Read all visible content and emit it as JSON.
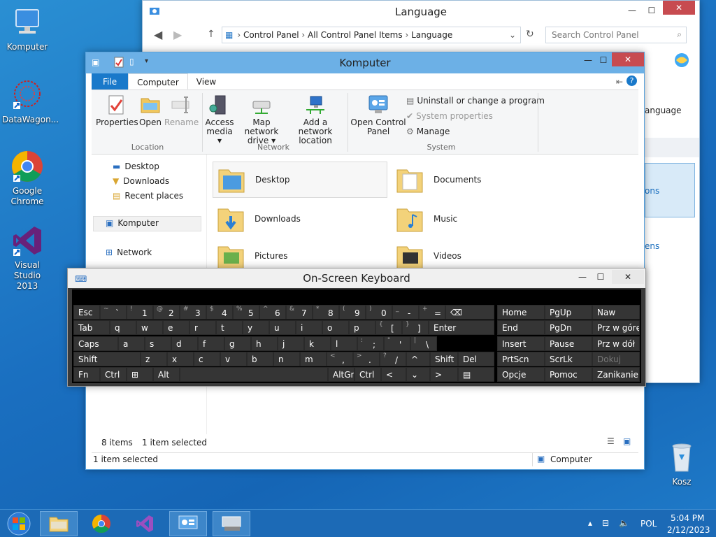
{
  "desktop": {
    "icons": [
      {
        "label": "Komputer"
      },
      {
        "label": "DataWagon..."
      },
      {
        "label": "Google Chrome"
      },
      {
        "label": "Visual Studio 2013"
      },
      {
        "label": "Kosz"
      }
    ]
  },
  "language_window": {
    "title": "Language",
    "breadcrumb": [
      "Control Panel",
      "All Control Panel Items",
      "Language"
    ],
    "search_placeholder": "Search Control Panel",
    "right_text": "anguage",
    "link1": "ons",
    "link2": "ens"
  },
  "komputer_window": {
    "title": "Komputer",
    "tabs": [
      "File",
      "Computer",
      "View"
    ],
    "ribbon": {
      "properties": "Properties",
      "open": "Open",
      "rename": "Rename",
      "location_group": "Location",
      "access_media": "Access media ▾",
      "map_network_drive": "Map network drive ▾",
      "add_network_location": "Add a network location",
      "network_group": "Network",
      "open_control_panel": "Open Control Panel",
      "uninstall": "Uninstall or change a program",
      "system_properties": "System properties",
      "manage": "Manage",
      "system_group": "System"
    },
    "nav": {
      "desktop": "Desktop",
      "downloads": "Downloads",
      "recent": "Recent places",
      "komputer": "Komputer",
      "network": "Network"
    },
    "folders": [
      "Desktop",
      "Documents",
      "Downloads",
      "Music",
      "Pictures",
      "Videos"
    ],
    "status_items": "8 items",
    "status_selected": "1 item selected",
    "status_bar_left": "1 item selected",
    "status_bar_right": "Computer"
  },
  "osk": {
    "title": "On-Screen Keyboard",
    "row1": [
      {
        "sub": "~",
        "main": "`"
      },
      {
        "sub": "!",
        "main": "1"
      },
      {
        "sub": "@",
        "main": "2"
      },
      {
        "sub": "#",
        "main": "3"
      },
      {
        "sub": "$",
        "main": "4"
      },
      {
        "sub": "%",
        "main": "5"
      },
      {
        "sub": "^",
        "main": "6"
      },
      {
        "sub": "&",
        "main": "7"
      },
      {
        "sub": "*",
        "main": "8"
      },
      {
        "sub": "(",
        "main": "9"
      },
      {
        "sub": ")",
        "main": "0"
      },
      {
        "sub": "_",
        "main": "-"
      },
      {
        "sub": "+",
        "main": "="
      }
    ],
    "row2": [
      "q",
      "w",
      "e",
      "r",
      "t",
      "y",
      "u",
      "i",
      "o",
      "p"
    ],
    "row2_brackets": [
      {
        "sub": "{",
        "main": "["
      },
      {
        "sub": "}",
        "main": "]"
      }
    ],
    "row3": [
      "a",
      "s",
      "d",
      "f",
      "g",
      "h",
      "j",
      "k",
      "l"
    ],
    "row3_punct": [
      {
        "sub": ":",
        "main": ";"
      },
      {
        "sub": "\"",
        "main": "'"
      },
      {
        "sub": "|",
        "main": "\\"
      }
    ],
    "row4": [
      "z",
      "x",
      "c",
      "v",
      "b",
      "n",
      "m"
    ],
    "row4_punct": [
      {
        "sub": "<",
        "main": ","
      },
      {
        "sub": ">",
        "main": "."
      },
      {
        "sub": "?",
        "main": "/"
      }
    ],
    "keys": {
      "esc": "Esc",
      "tab": "Tab",
      "caps": "Caps",
      "shift": "Shift",
      "fn": "Fn",
      "ctrl": "Ctrl",
      "alt": "Alt",
      "altgr": "AltGr",
      "enter": "Enter",
      "del": "Del",
      "up": "^",
      "left": "<",
      "down": "⌄",
      "right": ">"
    },
    "nav_keys": [
      [
        "Home",
        "PgUp",
        "Naw"
      ],
      [
        "End",
        "PgDn",
        "Prz w górę"
      ],
      [
        "Insert",
        "Pause",
        "Prz w dół"
      ],
      [
        "PrtScn",
        "ScrLk",
        "Dokuj"
      ],
      [
        "Opcje",
        "Pomoc",
        "Zanikanie"
      ]
    ]
  },
  "taskbar": {
    "lang": "POL",
    "time": "5:04 PM",
    "date": "2/12/2023"
  }
}
